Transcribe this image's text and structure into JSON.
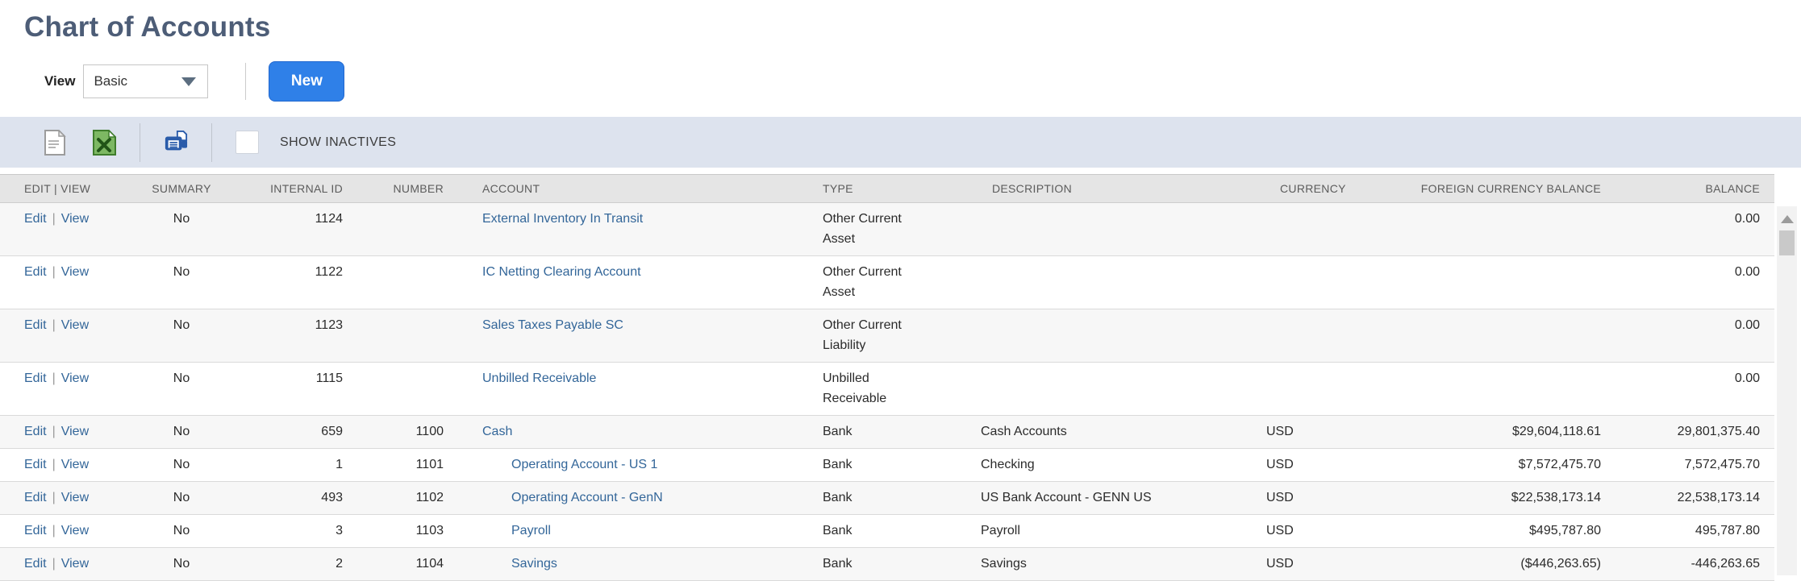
{
  "page": {
    "title": "Chart of Accounts"
  },
  "view_bar": {
    "label": "View",
    "selected": "Basic",
    "new_button": "New"
  },
  "toolbar": {
    "icons": {
      "export_csv": "csv-file-icon",
      "export_excel": "excel-file-icon",
      "print": "printer-icon"
    },
    "show_inactives_label": "SHOW INACTIVES",
    "show_inactives_checked": false
  },
  "table": {
    "edit_label": "Edit",
    "view_label": "View",
    "link_separator": "|",
    "headers": {
      "edit_view": "EDIT | VIEW",
      "summary": "SUMMARY",
      "internal_id": "INTERNAL ID",
      "number": "NUMBER",
      "account": "ACCOUNT",
      "type": "TYPE",
      "description": "DESCRIPTION",
      "currency": "CURRENCY",
      "foreign_currency_balance": "FOREIGN CURRENCY BALANCE",
      "balance": "BALANCE"
    },
    "rows": [
      {
        "summary": "No",
        "internal_id": "1124",
        "number": "",
        "account": "External Inventory In Transit",
        "indent": 0,
        "type": "Other Current Asset",
        "description": "",
        "currency": "",
        "foreign_currency_balance": "",
        "balance": "0.00"
      },
      {
        "summary": "No",
        "internal_id": "1122",
        "number": "",
        "account": "IC Netting Clearing Account",
        "indent": 0,
        "type": "Other Current Asset",
        "description": "",
        "currency": "",
        "foreign_currency_balance": "",
        "balance": "0.00"
      },
      {
        "summary": "No",
        "internal_id": "1123",
        "number": "",
        "account": "Sales Taxes Payable SC",
        "indent": 0,
        "type": "Other Current Liability",
        "description": "",
        "currency": "",
        "foreign_currency_balance": "",
        "balance": "0.00"
      },
      {
        "summary": "No",
        "internal_id": "1115",
        "number": "",
        "account": "Unbilled Receivable",
        "indent": 0,
        "type": "Unbilled Receivable",
        "description": "",
        "currency": "",
        "foreign_currency_balance": "",
        "balance": "0.00"
      },
      {
        "summary": "No",
        "internal_id": "659",
        "number": "1100",
        "account": "Cash",
        "indent": 0,
        "type": "Bank",
        "description": "Cash Accounts",
        "currency": "USD",
        "foreign_currency_balance": "$29,604,118.61",
        "balance": "29,801,375.40"
      },
      {
        "summary": "No",
        "internal_id": "1",
        "number": "1101",
        "account": "Operating Account - US 1",
        "indent": 1,
        "type": "Bank",
        "description": "Checking",
        "currency": "USD",
        "foreign_currency_balance": "$7,572,475.70",
        "balance": "7,572,475.70"
      },
      {
        "summary": "No",
        "internal_id": "493",
        "number": "1102",
        "account": "Operating Account - GenN",
        "indent": 1,
        "type": "Bank",
        "description": "US Bank Account - GENN US",
        "currency": "USD",
        "foreign_currency_balance": "$22,538,173.14",
        "balance": "22,538,173.14"
      },
      {
        "summary": "No",
        "internal_id": "3",
        "number": "1103",
        "account": "Payroll",
        "indent": 1,
        "type": "Bank",
        "description": "Payroll",
        "currency": "USD",
        "foreign_currency_balance": "$495,787.80",
        "balance": "495,787.80"
      },
      {
        "summary": "No",
        "internal_id": "2",
        "number": "1104",
        "account": "Savings",
        "indent": 1,
        "type": "Bank",
        "description": "Savings",
        "currency": "USD",
        "foreign_currency_balance": "($446,263.65)",
        "balance": "-446,263.65"
      }
    ]
  },
  "colors": {
    "title": "#4d5d77",
    "link_blue": "#336699",
    "button_blue": "#2f80e8",
    "toolbar_bg": "#dde3ee",
    "header_bg": "#e5e5e5",
    "row_alt_bg": "#f7f7f7"
  }
}
